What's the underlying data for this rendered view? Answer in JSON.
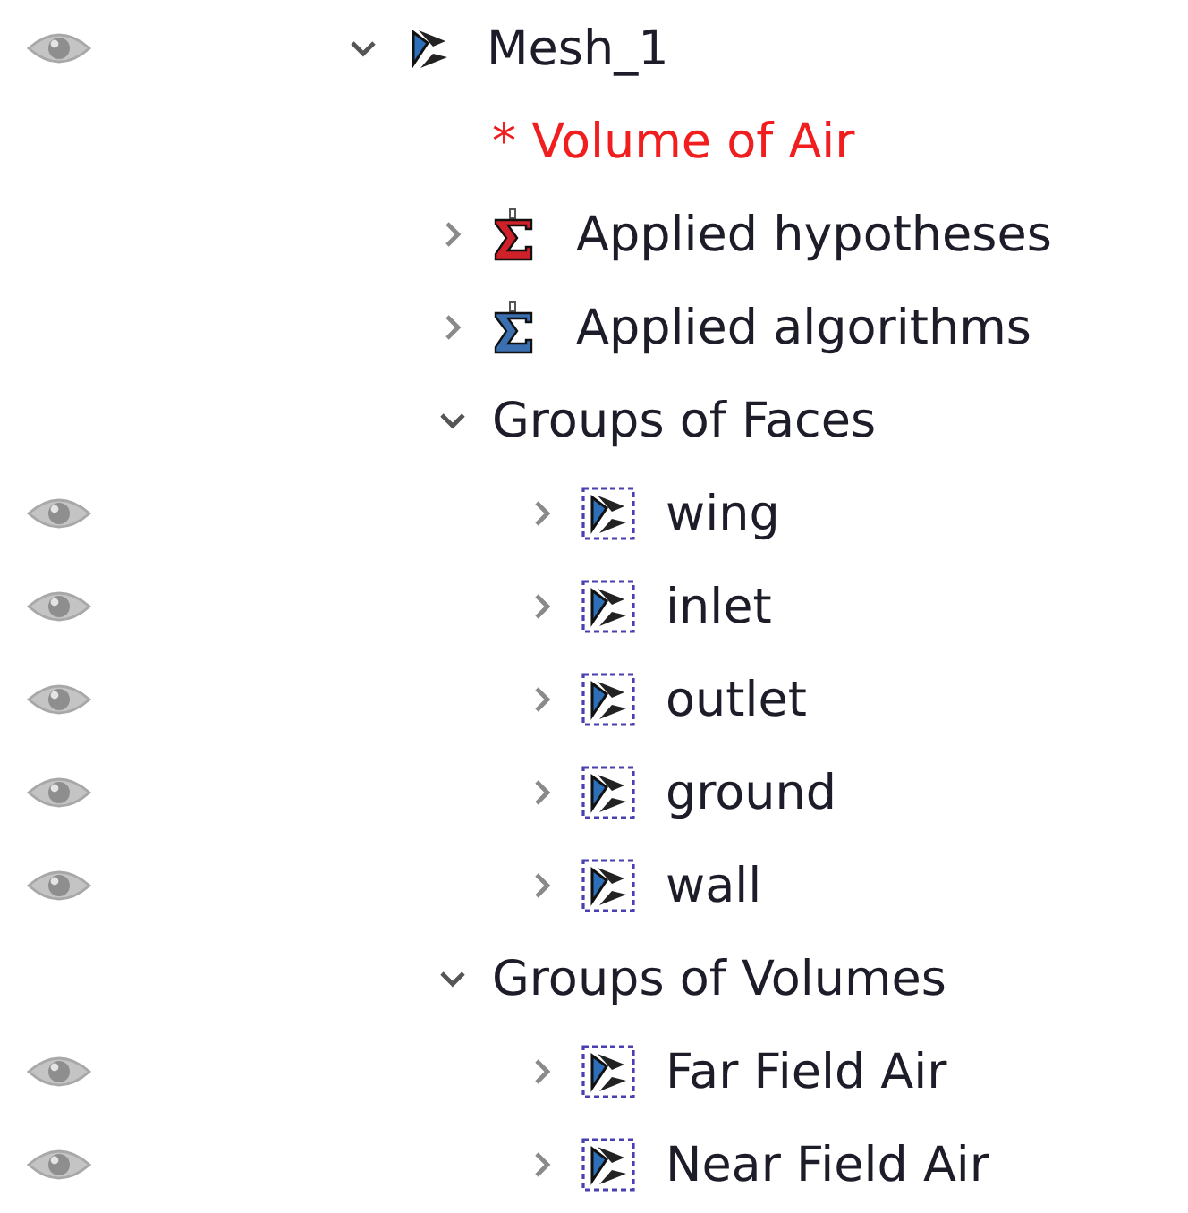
{
  "tree": [
    {
      "label": "Mesh_1",
      "kind": "mesh",
      "visible": true,
      "expanded": true,
      "children": [
        {
          "label": "* Volume of Air",
          "kind": "note",
          "visible": false
        },
        {
          "label": "Applied hypotheses",
          "kind": "hypotheses",
          "visible": false,
          "expanded": false
        },
        {
          "label": "Applied algorithms",
          "kind": "algorithms",
          "visible": false,
          "expanded": false
        },
        {
          "label": "Groups of Faces",
          "kind": "folder",
          "visible": false,
          "expanded": true,
          "children": [
            {
              "label": "wing",
              "kind": "group",
              "visible": true,
              "expanded": false
            },
            {
              "label": "inlet",
              "kind": "group",
              "visible": true,
              "expanded": false
            },
            {
              "label": "outlet",
              "kind": "group",
              "visible": true,
              "expanded": false
            },
            {
              "label": "ground",
              "kind": "group",
              "visible": true,
              "expanded": false
            },
            {
              "label": "wall",
              "kind": "group",
              "visible": true,
              "expanded": false
            }
          ]
        },
        {
          "label": "Groups of Volumes",
          "kind": "folder",
          "visible": false,
          "expanded": true,
          "children": [
            {
              "label": "Far Field Air",
              "kind": "group",
              "visible": true,
              "expanded": false
            },
            {
              "label": "Near Field Air",
              "kind": "group",
              "visible": true,
              "expanded": false
            }
          ]
        }
      ]
    }
  ]
}
